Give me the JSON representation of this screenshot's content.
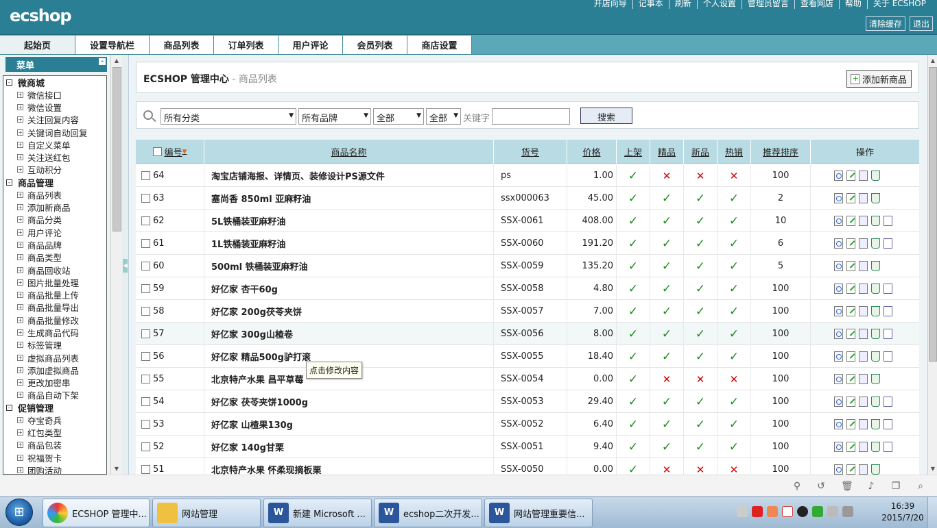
{
  "top": {
    "logo": "ecshop",
    "links": [
      "开店向导",
      "记事本",
      "刷新",
      "个人设置",
      "管理员留言",
      "查看网店",
      "帮助",
      "关于 ECSHOP"
    ],
    "buttons": [
      "清除缓存",
      "退出"
    ]
  },
  "tabs": [
    "起始页",
    "设置导航栏",
    "商品列表",
    "订单列表",
    "用户评论",
    "会员列表",
    "商店设置"
  ],
  "menu": {
    "title": "菜单",
    "groups": [
      {
        "label": "微商城",
        "items": [
          "微信接口",
          "微信设置",
          "关注回复内容",
          "关键词自动回复",
          "自定义菜单",
          "关注送红包",
          "互动积分"
        ]
      },
      {
        "label": "商品管理",
        "items": [
          "商品列表",
          "添加新商品",
          "商品分类",
          "用户评论",
          "商品品牌",
          "商品类型",
          "商品回收站",
          "图片批量处理",
          "商品批量上传",
          "商品批量导出",
          "商品批量修改",
          "生成商品代码",
          "标签管理",
          "虚拟商品列表",
          "添加虚拟商品",
          "更改加密串",
          "商品自动下架"
        ]
      },
      {
        "label": "促销管理",
        "items": [
          "夺宝奇兵",
          "红包类型",
          "商品包装",
          "祝福贺卡",
          "团购活动"
        ]
      }
    ]
  },
  "header": {
    "title": "ECSHOP 管理中心",
    "subtitle": " - 商品列表",
    "add_button": "添加新商品"
  },
  "search": {
    "category": "所有分类",
    "brand": "所有品牌",
    "filter1": "全部",
    "filter2": "全部",
    "keyword_label": "关键字",
    "keyword_value": "",
    "button": "搜索"
  },
  "table": {
    "headers": {
      "id": "编号",
      "name": "商品名称",
      "sn": "货号",
      "price": "价格",
      "on_sale": "上架",
      "best": "精品",
      "new": "新品",
      "hot": "热销",
      "sort": "推荐排序",
      "ops": "操作"
    },
    "rows": [
      {
        "id": "64",
        "name": "淘宝店铺海报、详情页、装修设计PS源文件",
        "sn": "ps",
        "price": "1.00",
        "on_sale": true,
        "best": false,
        "new": false,
        "hot": false,
        "sort": "100",
        "dup": false
      },
      {
        "id": "63",
        "name": "塞尚香  850ml 亚麻籽油",
        "sn": "ssx000063",
        "price": "45.00",
        "on_sale": true,
        "best": true,
        "new": true,
        "hot": true,
        "sort": "2",
        "dup": false
      },
      {
        "id": "62",
        "name": "5L铁桶装亚麻籽油",
        "sn": "SSX-0061",
        "price": "408.00",
        "on_sale": true,
        "best": true,
        "new": true,
        "hot": true,
        "sort": "10",
        "dup": true
      },
      {
        "id": "61",
        "name": "1L铁桶装亚麻籽油",
        "sn": "SSX-0060",
        "price": "191.20",
        "on_sale": true,
        "best": true,
        "new": true,
        "hot": true,
        "sort": "6",
        "dup": true
      },
      {
        "id": "60",
        "name": "500ml 铁桶装亚麻籽油",
        "sn": "SSX-0059",
        "price": "135.20",
        "on_sale": true,
        "best": true,
        "new": true,
        "hot": true,
        "sort": "5",
        "dup": false
      },
      {
        "id": "59",
        "name": "好亿家  杏干60g",
        "sn": "SSX-0058",
        "price": "4.80",
        "on_sale": true,
        "best": true,
        "new": true,
        "hot": true,
        "sort": "100",
        "dup": true
      },
      {
        "id": "58",
        "name": "好亿家  200g茯苓夹饼",
        "sn": "SSX-0057",
        "price": "7.00",
        "on_sale": true,
        "best": true,
        "new": true,
        "hot": true,
        "sort": "100",
        "dup": true
      },
      {
        "id": "57",
        "name": "好亿家  300g山楂卷",
        "sn": "SSX-0056",
        "price": "8.00",
        "on_sale": true,
        "best": true,
        "new": true,
        "hot": true,
        "sort": "100",
        "dup": true
      },
      {
        "id": "56",
        "name": "好亿家  精品500g驴打滚",
        "sn": "SSX-0055",
        "price": "18.40",
        "on_sale": true,
        "best": true,
        "new": true,
        "hot": true,
        "sort": "100",
        "dup": true
      },
      {
        "id": "55",
        "name": "北京特产水果  昌平草莓",
        "sn": "SSX-0054",
        "price": "0.00",
        "on_sale": true,
        "best": false,
        "new": false,
        "hot": false,
        "sort": "100",
        "dup": false
      },
      {
        "id": "54",
        "name": "好亿家  茯苓夹饼1000g",
        "sn": "SSX-0053",
        "price": "29.40",
        "on_sale": true,
        "best": true,
        "new": true,
        "hot": true,
        "sort": "100",
        "dup": true
      },
      {
        "id": "53",
        "name": "好亿家  山楂果130g",
        "sn": "SSX-0052",
        "price": "6.40",
        "on_sale": true,
        "best": true,
        "new": true,
        "hot": true,
        "sort": "100",
        "dup": true
      },
      {
        "id": "52",
        "name": "好亿家  140g甘栗",
        "sn": "SSX-0051",
        "price": "9.40",
        "on_sale": true,
        "best": true,
        "new": true,
        "hot": true,
        "sort": "100",
        "dup": true
      },
      {
        "id": "51",
        "name": "北京特产水果  怀柔现摘板栗",
        "sn": "SSX-0050",
        "price": "0.00",
        "on_sale": true,
        "best": false,
        "new": false,
        "hot": false,
        "sort": "100",
        "dup": false
      }
    ]
  },
  "tooltip": "点击修改内容",
  "taskbar": {
    "items": [
      "ECSHOP 管理中...",
      "网站管理",
      "新建 Microsoft ...",
      "ecshop二次开发...",
      "网站管理重要信..."
    ],
    "time": "16:39",
    "date": "2015/7/20"
  },
  "colors": {
    "header": "#2a7f94",
    "table_header": "#b9dbe3",
    "check": "#1b8a1b",
    "cross": "#d40000"
  }
}
